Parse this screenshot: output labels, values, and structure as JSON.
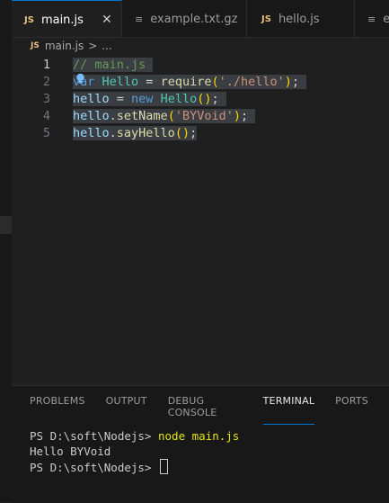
{
  "tabs": [
    {
      "icon": "js-file-icon",
      "badge": "JS",
      "label": "main.js",
      "active": true,
      "close": "✕"
    },
    {
      "icon": "text-file-icon",
      "label": "example.txt.gz"
    },
    {
      "icon": "js-file-icon",
      "badge": "JS",
      "label": "hello.js"
    },
    {
      "icon": "text-file-icon",
      "label": "e"
    }
  ],
  "breadcrumb": {
    "badge": "JS",
    "file": "main.js",
    "sep": ">",
    "rest": "..."
  },
  "editor": {
    "line_numbers": [
      "1",
      "2",
      "3",
      "4",
      "5"
    ],
    "lines": [
      "// main.js",
      "var Hello = require('./hello');",
      "hello = new Hello();",
      "hello.setName('BYVoid');",
      "hello.sayHello();"
    ]
  },
  "panel": {
    "tabs": [
      "PROBLEMS",
      "OUTPUT",
      "DEBUG CONSOLE",
      "TERMINAL",
      "PORTS"
    ],
    "active_tab": "TERMINAL",
    "terminal": {
      "prompt": "PS D:\\soft\\Nodejs> ",
      "command": "node main.js",
      "output": "Hello BYVoid",
      "prompt2": "PS D:\\soft\\Nodejs> "
    }
  },
  "colors": {
    "accent": "#0078d4",
    "background": "#1f1f1f",
    "selection": "#3a3d41"
  }
}
